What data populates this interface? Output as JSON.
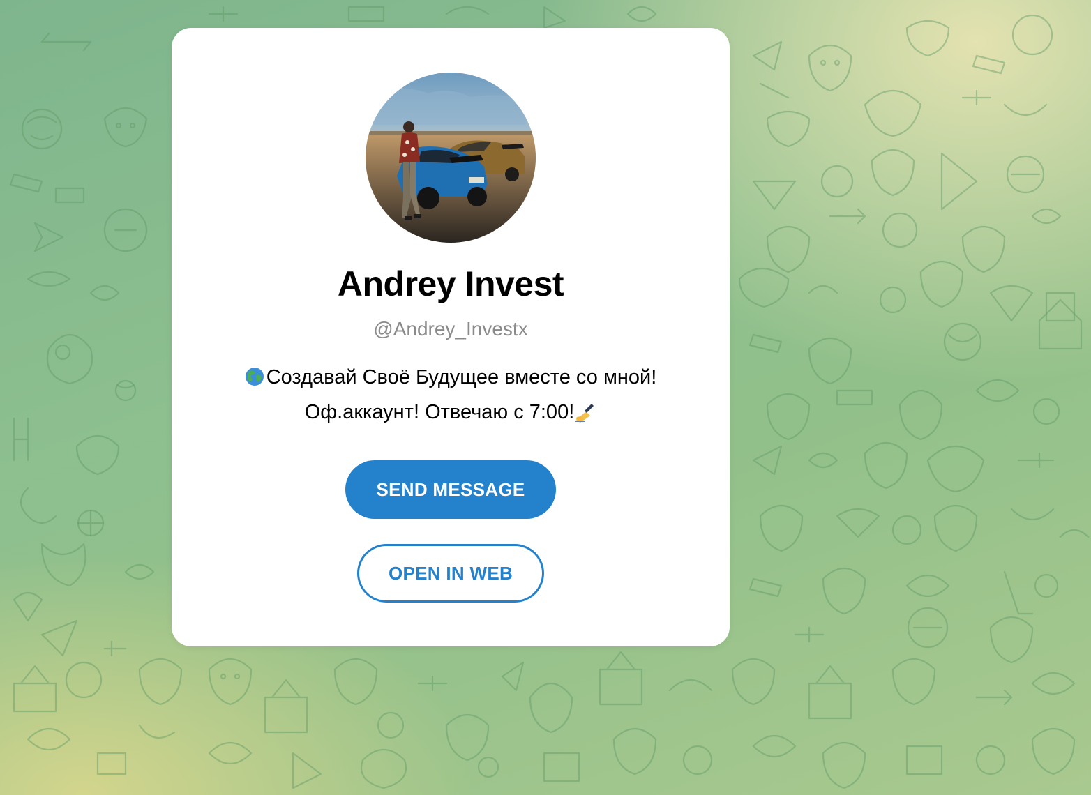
{
  "theme": {
    "accent": "#2481cc",
    "card_bg": "#ffffff",
    "background_start": "#7fb58d",
    "background_end": "#e8e4b2",
    "username_color": "#8a8a8a"
  },
  "profile": {
    "name": "Andrey Invest",
    "username": "@Andrey_Investx",
    "description_line1_icon": "globe-emoji",
    "description_line1": "Создавай Своё Будущее вместе со мной!",
    "description_line2": "Оф.аккаунт! Отвечаю с 7:00!",
    "description_line2_icon": "writing-hand-emoji",
    "avatar_icon": "profile-photo"
  },
  "actions": {
    "send_message_label": "SEND MESSAGE",
    "open_in_web_label": "OPEN IN WEB"
  },
  "background": {
    "pattern_icon": "doodle-pattern"
  }
}
